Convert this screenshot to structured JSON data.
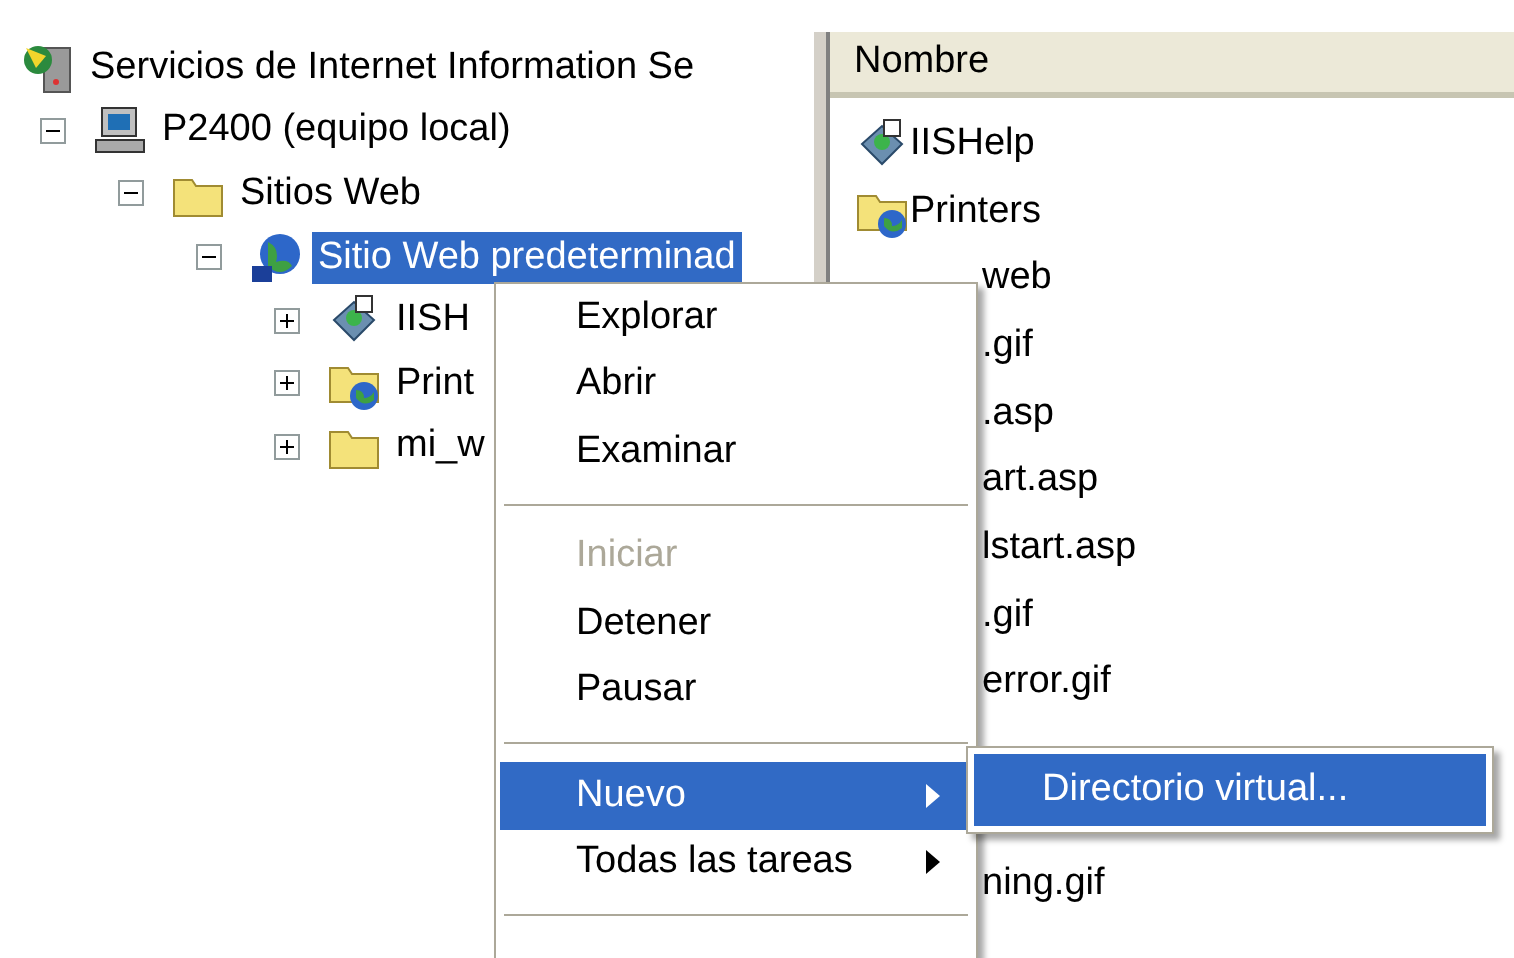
{
  "tree": [
    {
      "label": "Servicios de Internet Information Se",
      "kind": "server",
      "selected": false,
      "children": [
        {
          "label": "P2400 (equipo local)",
          "kind": "computer",
          "expanded": true,
          "selected": false,
          "children": [
            {
              "label": "Sitios Web",
              "kind": "folder",
              "expanded": true,
              "selected": false,
              "children": [
                {
                  "label": "Sitio Web predeterminad",
                  "kind": "globe",
                  "expanded": true,
                  "selected": true,
                  "children": [
                    {
                      "label": "IISH",
                      "kind": "gear",
                      "expanded": false,
                      "selected": false
                    },
                    {
                      "label": "Print",
                      "kind": "folderglobe",
                      "expanded": false,
                      "selected": false
                    },
                    {
                      "label": "mi_w",
                      "kind": "folder",
                      "expanded": false,
                      "selected": false
                    }
                  ]
                }
              ]
            }
          ]
        }
      ]
    }
  ],
  "list": {
    "header": "Nombre",
    "rows": [
      {
        "kind": "gear",
        "label": "IISHelp"
      },
      {
        "kind": "folderglobe",
        "label": "Printers"
      },
      {
        "kind": "partial",
        "label": "web"
      },
      {
        "kind": "partial",
        "label": ".gif"
      },
      {
        "kind": "partial",
        "label": ".asp"
      },
      {
        "kind": "partial",
        "label": "art.asp"
      },
      {
        "kind": "partial",
        "label": "lstart.asp"
      },
      {
        "kind": "partial",
        "label": ".gif"
      },
      {
        "kind": "partial",
        "label": "error.gif"
      },
      {
        "kind": "covered"
      },
      {
        "kind": "covered"
      },
      {
        "kind": "partial",
        "label": "ning.gif"
      }
    ]
  },
  "context_menu": {
    "items": [
      {
        "kind": "item",
        "label": "Explorar",
        "disabled": false,
        "selected": false
      },
      {
        "kind": "item",
        "label": "Abrir",
        "disabled": false,
        "selected": false
      },
      {
        "kind": "item",
        "label": "Examinar",
        "disabled": false,
        "selected": false
      },
      {
        "kind": "separator"
      },
      {
        "kind": "item",
        "label": "Iniciar",
        "disabled": true,
        "selected": false
      },
      {
        "kind": "item",
        "label": "Detener",
        "disabled": false,
        "selected": false
      },
      {
        "kind": "item",
        "label": "Pausar",
        "disabled": false,
        "selected": false
      },
      {
        "kind": "separator"
      },
      {
        "kind": "submenu",
        "label": "Nuevo",
        "disabled": false,
        "selected": true
      },
      {
        "kind": "submenu",
        "label": "Todas las tareas",
        "disabled": false,
        "selected": false
      },
      {
        "kind": "separator"
      }
    ]
  },
  "submenu": {
    "items": [
      {
        "label": "Directorio virtual...",
        "selected": true
      }
    ]
  }
}
